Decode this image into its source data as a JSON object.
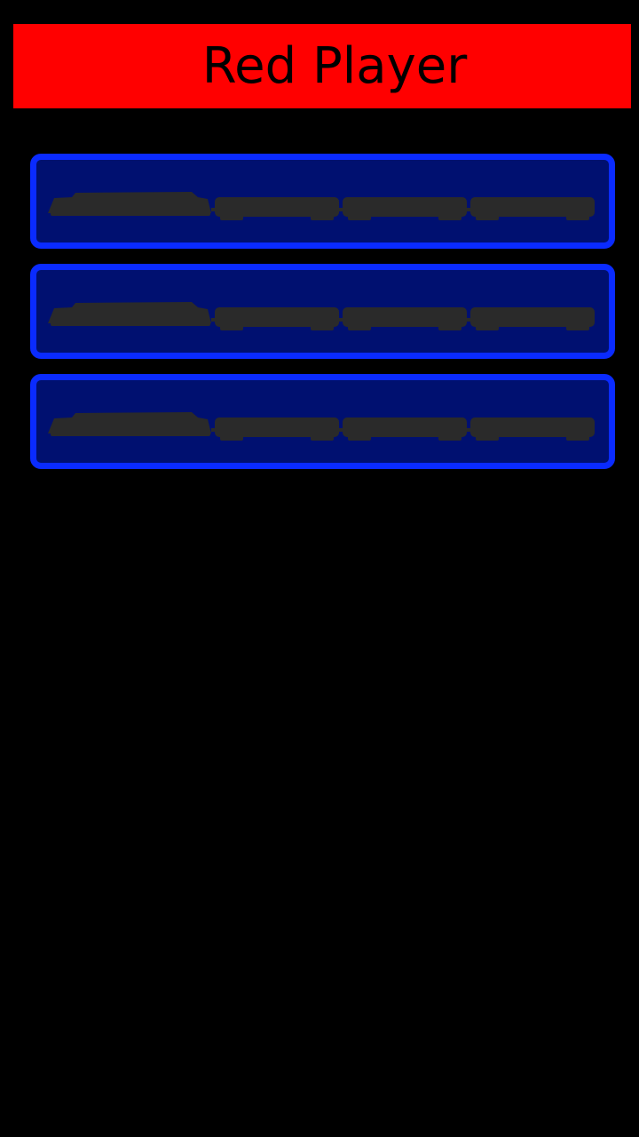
{
  "header": {
    "title": "Red Player",
    "background_color": "#ff0000",
    "text_color": "#000000"
  },
  "colors": {
    "page_background": "#000000",
    "card_fill": "#001070",
    "card_border": "#0a2bff",
    "train_silhouette": "#2a2a2a"
  },
  "trains": [
    {
      "cars": 4,
      "icon": "train-icon"
    },
    {
      "cars": 4,
      "icon": "train-icon"
    },
    {
      "cars": 4,
      "icon": "train-icon"
    }
  ]
}
